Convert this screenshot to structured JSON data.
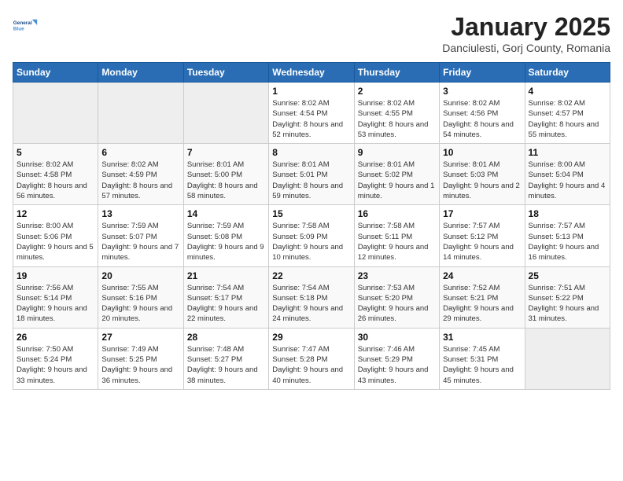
{
  "header": {
    "logo_line1": "General",
    "logo_line2": "Blue",
    "title": "January 2025",
    "subtitle": "Danciulesti, Gorj County, Romania"
  },
  "weekdays": [
    "Sunday",
    "Monday",
    "Tuesday",
    "Wednesday",
    "Thursday",
    "Friday",
    "Saturday"
  ],
  "weeks": [
    [
      {
        "day": "",
        "info": ""
      },
      {
        "day": "",
        "info": ""
      },
      {
        "day": "",
        "info": ""
      },
      {
        "day": "1",
        "info": "Sunrise: 8:02 AM\nSunset: 4:54 PM\nDaylight: 8 hours and 52 minutes."
      },
      {
        "day": "2",
        "info": "Sunrise: 8:02 AM\nSunset: 4:55 PM\nDaylight: 8 hours and 53 minutes."
      },
      {
        "day": "3",
        "info": "Sunrise: 8:02 AM\nSunset: 4:56 PM\nDaylight: 8 hours and 54 minutes."
      },
      {
        "day": "4",
        "info": "Sunrise: 8:02 AM\nSunset: 4:57 PM\nDaylight: 8 hours and 55 minutes."
      }
    ],
    [
      {
        "day": "5",
        "info": "Sunrise: 8:02 AM\nSunset: 4:58 PM\nDaylight: 8 hours and 56 minutes."
      },
      {
        "day": "6",
        "info": "Sunrise: 8:02 AM\nSunset: 4:59 PM\nDaylight: 8 hours and 57 minutes."
      },
      {
        "day": "7",
        "info": "Sunrise: 8:01 AM\nSunset: 5:00 PM\nDaylight: 8 hours and 58 minutes."
      },
      {
        "day": "8",
        "info": "Sunrise: 8:01 AM\nSunset: 5:01 PM\nDaylight: 8 hours and 59 minutes."
      },
      {
        "day": "9",
        "info": "Sunrise: 8:01 AM\nSunset: 5:02 PM\nDaylight: 9 hours and 1 minute."
      },
      {
        "day": "10",
        "info": "Sunrise: 8:01 AM\nSunset: 5:03 PM\nDaylight: 9 hours and 2 minutes."
      },
      {
        "day": "11",
        "info": "Sunrise: 8:00 AM\nSunset: 5:04 PM\nDaylight: 9 hours and 4 minutes."
      }
    ],
    [
      {
        "day": "12",
        "info": "Sunrise: 8:00 AM\nSunset: 5:06 PM\nDaylight: 9 hours and 5 minutes."
      },
      {
        "day": "13",
        "info": "Sunrise: 7:59 AM\nSunset: 5:07 PM\nDaylight: 9 hours and 7 minutes."
      },
      {
        "day": "14",
        "info": "Sunrise: 7:59 AM\nSunset: 5:08 PM\nDaylight: 9 hours and 9 minutes."
      },
      {
        "day": "15",
        "info": "Sunrise: 7:58 AM\nSunset: 5:09 PM\nDaylight: 9 hours and 10 minutes."
      },
      {
        "day": "16",
        "info": "Sunrise: 7:58 AM\nSunset: 5:11 PM\nDaylight: 9 hours and 12 minutes."
      },
      {
        "day": "17",
        "info": "Sunrise: 7:57 AM\nSunset: 5:12 PM\nDaylight: 9 hours and 14 minutes."
      },
      {
        "day": "18",
        "info": "Sunrise: 7:57 AM\nSunset: 5:13 PM\nDaylight: 9 hours and 16 minutes."
      }
    ],
    [
      {
        "day": "19",
        "info": "Sunrise: 7:56 AM\nSunset: 5:14 PM\nDaylight: 9 hours and 18 minutes."
      },
      {
        "day": "20",
        "info": "Sunrise: 7:55 AM\nSunset: 5:16 PM\nDaylight: 9 hours and 20 minutes."
      },
      {
        "day": "21",
        "info": "Sunrise: 7:54 AM\nSunset: 5:17 PM\nDaylight: 9 hours and 22 minutes."
      },
      {
        "day": "22",
        "info": "Sunrise: 7:54 AM\nSunset: 5:18 PM\nDaylight: 9 hours and 24 minutes."
      },
      {
        "day": "23",
        "info": "Sunrise: 7:53 AM\nSunset: 5:20 PM\nDaylight: 9 hours and 26 minutes."
      },
      {
        "day": "24",
        "info": "Sunrise: 7:52 AM\nSunset: 5:21 PM\nDaylight: 9 hours and 29 minutes."
      },
      {
        "day": "25",
        "info": "Sunrise: 7:51 AM\nSunset: 5:22 PM\nDaylight: 9 hours and 31 minutes."
      }
    ],
    [
      {
        "day": "26",
        "info": "Sunrise: 7:50 AM\nSunset: 5:24 PM\nDaylight: 9 hours and 33 minutes."
      },
      {
        "day": "27",
        "info": "Sunrise: 7:49 AM\nSunset: 5:25 PM\nDaylight: 9 hours and 36 minutes."
      },
      {
        "day": "28",
        "info": "Sunrise: 7:48 AM\nSunset: 5:27 PM\nDaylight: 9 hours and 38 minutes."
      },
      {
        "day": "29",
        "info": "Sunrise: 7:47 AM\nSunset: 5:28 PM\nDaylight: 9 hours and 40 minutes."
      },
      {
        "day": "30",
        "info": "Sunrise: 7:46 AM\nSunset: 5:29 PM\nDaylight: 9 hours and 43 minutes."
      },
      {
        "day": "31",
        "info": "Sunrise: 7:45 AM\nSunset: 5:31 PM\nDaylight: 9 hours and 45 minutes."
      },
      {
        "day": "",
        "info": ""
      }
    ]
  ]
}
